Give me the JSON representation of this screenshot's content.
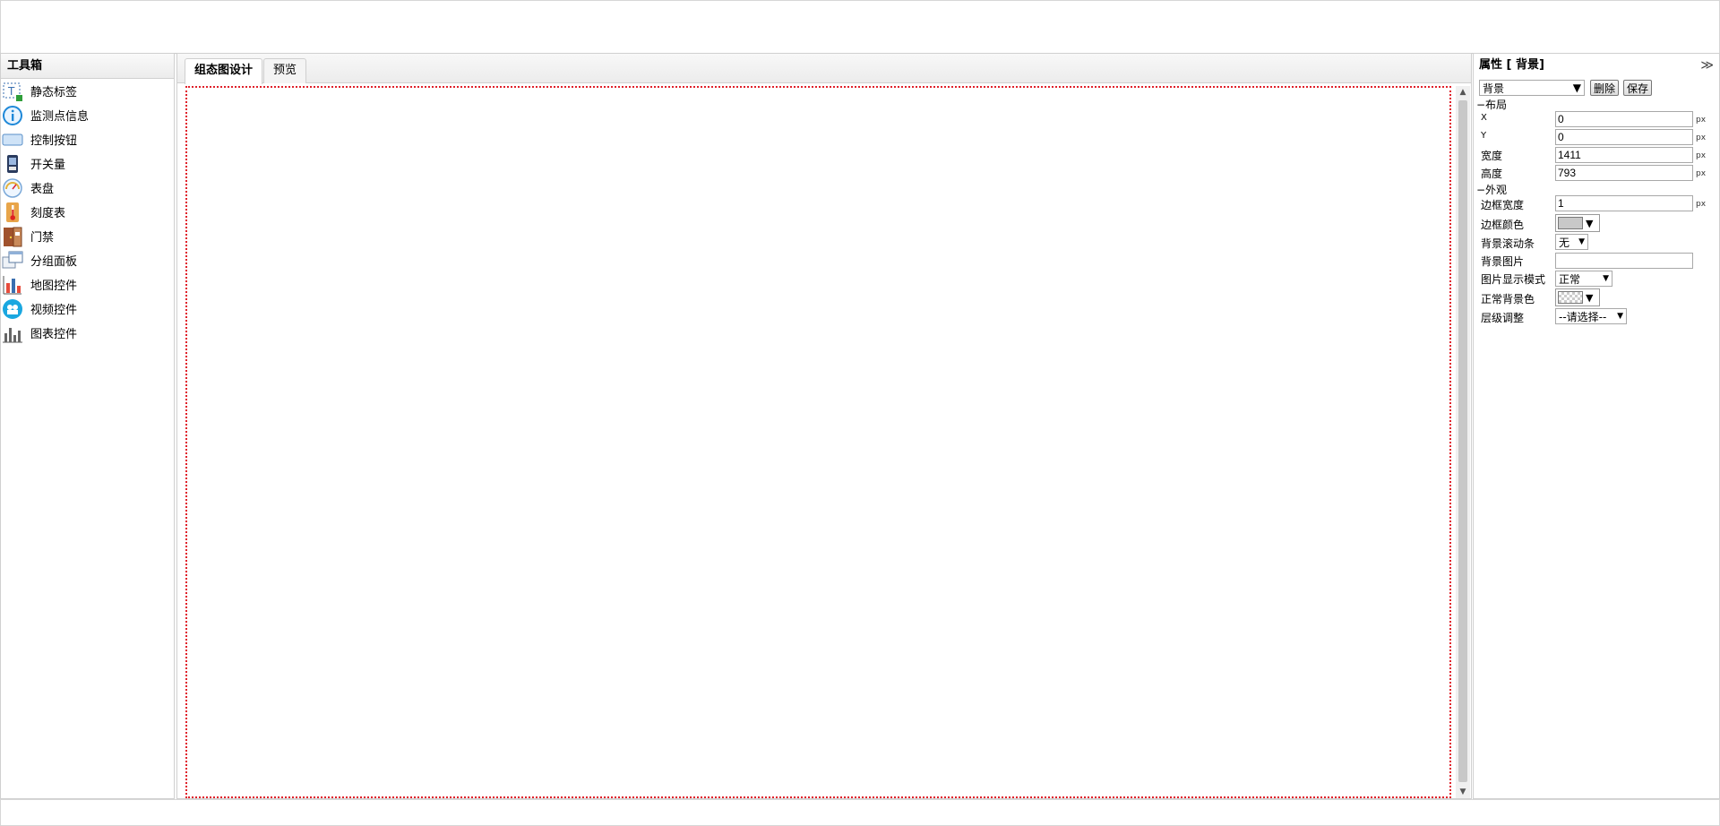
{
  "toolbox": {
    "title": "工具箱",
    "items": [
      {
        "label": "静态标签",
        "icon": "static-label-icon"
      },
      {
        "label": "监测点信息",
        "icon": "info-icon"
      },
      {
        "label": "控制按钮",
        "icon": "control-button-icon"
      },
      {
        "label": "开关量",
        "icon": "switch-icon"
      },
      {
        "label": "表盘",
        "icon": "dial-icon"
      },
      {
        "label": "刻度表",
        "icon": "thermometer-icon"
      },
      {
        "label": "门禁",
        "icon": "door-icon"
      },
      {
        "label": "分组面板",
        "icon": "panel-icon"
      },
      {
        "label": "地图控件",
        "icon": "map-icon"
      },
      {
        "label": "视频控件",
        "icon": "video-icon"
      },
      {
        "label": "图表控件",
        "icon": "chart-icon"
      }
    ]
  },
  "tabs": [
    {
      "label": "组态图设计",
      "active": true
    },
    {
      "label": "预览",
      "active": false
    }
  ],
  "props": {
    "title": "属性 [ 背景]",
    "collapse": "≫",
    "selected": "背景",
    "delete_label": "删除",
    "save_label": "保存",
    "layout_section": "−布局",
    "x_label": "X",
    "x_value": "0",
    "y_label": "Y",
    "y_value": "0",
    "width_label": "宽度",
    "width_value": "1411",
    "height_label": "高度",
    "height_value": "793",
    "unit": "px",
    "appearance_section": "−外观",
    "border_width_label": "边框宽度",
    "border_width_value": "1",
    "border_color_label": "边框颜色",
    "border_color": "#c8c8c8",
    "scroll_label": "背景滚动条",
    "scroll_value": "无",
    "bg_image_label": "背景图片",
    "bg_image_value": "",
    "display_mode_label": "图片显示模式",
    "display_mode_value": "正常",
    "normal_bg_label": "正常背景色",
    "layer_label": "层级调整",
    "layer_value": "--请选择--"
  }
}
